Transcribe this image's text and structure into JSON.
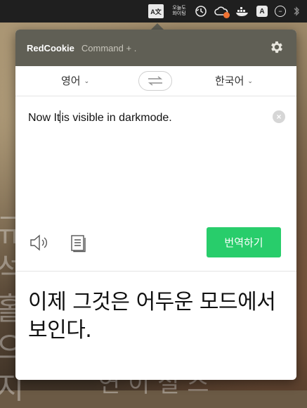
{
  "menubar": {
    "translate_icon": "translate-icon",
    "translate_glyph": "A文",
    "ohwa_top": "오늘도",
    "ohwa_bottom": "화이팅",
    "icons": [
      "translate-icon",
      "todo-icon",
      "time-machine-icon",
      "creative-cloud-icon",
      "docker-icon",
      "a-box-icon",
      "no-entry-icon",
      "bluetooth-icon"
    ]
  },
  "wallpaper": {
    "side_glyphs": [
      "규",
      "석",
      "홀",
      "으",
      "지"
    ],
    "bottom_glyphs": "연 이 설 스"
  },
  "popover": {
    "app_title": "RedCookie",
    "shortcut": "Command + .",
    "settings_icon": "gear-icon",
    "source_language": "영어",
    "target_language": "한국어",
    "swap_glyph": "⇌",
    "source_text_before_caret": "Now It",
    "source_text_after_caret": "is visible in darkmode.",
    "clear_glyph": "×",
    "translate_button": "번역하기",
    "result_text": "이제 그것은 어두운 모드에서 보인다."
  },
  "colors": {
    "header_bg": "#605f55",
    "translate_button_bg": "#28cd6b",
    "menubar_bg": "#1f1f1f"
  }
}
